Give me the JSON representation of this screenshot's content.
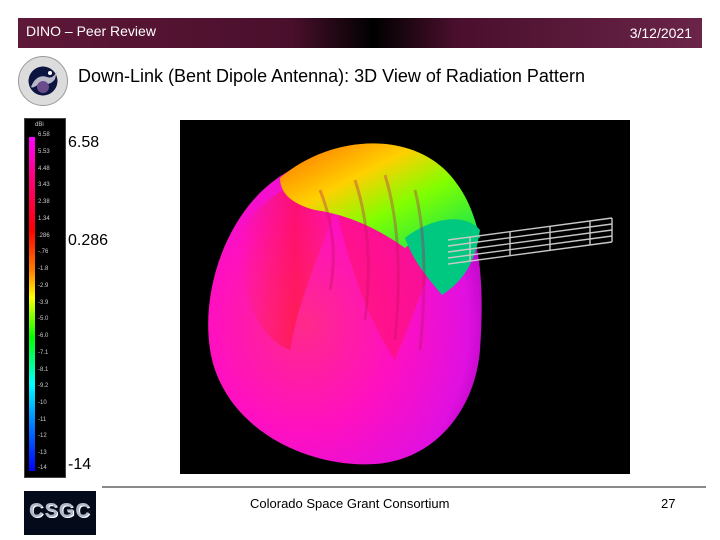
{
  "header": {
    "left_text": "DINO – Peer Review",
    "date": "3/12/2021"
  },
  "title": "Down-Link (Bent Dipole Antenna):  3D View of Radiation Pattern",
  "colorbar": {
    "unit": "dBi",
    "ticks": [
      "6.58",
      "5.53",
      "4.48",
      "3.43",
      "2.38",
      "1.34",
      ".286",
      "-.76",
      "-1.8",
      "-2.9",
      "-3.9",
      "-5.0",
      "-6.0",
      "-7.1",
      "-8.1",
      "-9.2",
      "-10",
      "-11",
      "-12",
      "-13",
      "-14"
    ],
    "labels": {
      "max": "6.58",
      "mid": "0.286",
      "min": "-14"
    }
  },
  "footer": {
    "org": "Colorado Space Grant Consortium",
    "page": "27",
    "logo_text": "CSGC"
  },
  "colors": {
    "header_bg": "#4a0f2c",
    "viz_bg": "#000000"
  }
}
